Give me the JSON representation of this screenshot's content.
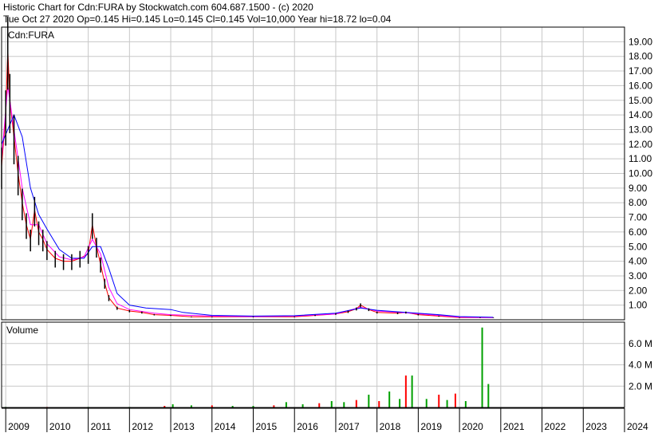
{
  "header": {
    "line1": "Historic Chart for Cdn:FURA by Stockwatch.com 604.687.1500 - (c) 2020",
    "line2": "Tue Oct 27 2020  Op=0.145  Hi=0.145  Lo=0.145  Cl=0.145  Vol=10,000  Year hi=18.72  lo=0.04"
  },
  "chart_data": {
    "type": "line",
    "symbol": "Cdn:FURA",
    "volume_label": "Volume",
    "x_axis": {
      "ticks": [
        "2009",
        "2010",
        "2011",
        "2012",
        "2013",
        "2014",
        "2015",
        "2016",
        "2017",
        "2018",
        "2019",
        "2020",
        "2021",
        "2022",
        "2023",
        "2024"
      ],
      "range": [
        2008.9,
        2024.0
      ]
    },
    "price_axis": {
      "ticks": [
        "19.00",
        "18.00",
        "17.00",
        "16.00",
        "15.00",
        "14.00",
        "13.00",
        "12.00",
        "11.00",
        "10.00",
        "9.00",
        "8.00",
        "7.00",
        "6.00",
        "5.00",
        "4.00",
        "3.00",
        "2.00",
        "1.00"
      ],
      "range": [
        0,
        20.0
      ]
    },
    "volume_axis": {
      "ticks": [
        "6.0 M",
        "4.0 M",
        "2.0 M"
      ],
      "range": [
        0,
        8.0
      ]
    },
    "grid": true,
    "colors": {
      "price": "#000000",
      "ma_short": "#ff0000",
      "ma_mid": "#ff00ff",
      "ma_long": "#0000ff",
      "vol_up": "#00a000",
      "vol_down": "#ff0000"
    },
    "series": [
      {
        "values": [
          [
            2008.9,
            10.5
          ],
          [
            2009.0,
            14.0
          ],
          [
            2009.05,
            18.5
          ],
          [
            2009.1,
            15.0
          ],
          [
            2009.2,
            12.5
          ],
          [
            2009.3,
            10.0
          ],
          [
            2009.4,
            8.0
          ],
          [
            2009.5,
            6.5
          ],
          [
            2009.6,
            5.5
          ],
          [
            2009.7,
            7.5
          ],
          [
            2009.8,
            6.0
          ],
          [
            2009.9,
            5.5
          ],
          [
            2010.0,
            4.8
          ],
          [
            2010.2,
            4.2
          ],
          [
            2010.4,
            4.0
          ],
          [
            2010.6,
            4.0
          ],
          [
            2010.8,
            4.2
          ],
          [
            2011.0,
            4.5
          ],
          [
            2011.1,
            6.5
          ],
          [
            2011.2,
            5.0
          ],
          [
            2011.3,
            3.8
          ],
          [
            2011.4,
            2.5
          ],
          [
            2011.5,
            1.5
          ],
          [
            2011.7,
            0.8
          ],
          [
            2012.0,
            0.6
          ],
          [
            2012.3,
            0.5
          ],
          [
            2012.6,
            0.35
          ],
          [
            2013.0,
            0.3
          ],
          [
            2013.5,
            0.2
          ],
          [
            2014.0,
            0.2
          ],
          [
            2015.0,
            0.2
          ],
          [
            2016.0,
            0.2
          ],
          [
            2016.5,
            0.3
          ],
          [
            2017.0,
            0.4
          ],
          [
            2017.3,
            0.55
          ],
          [
            2017.5,
            0.75
          ],
          [
            2017.6,
            1.0
          ],
          [
            2017.8,
            0.7
          ],
          [
            2018.0,
            0.5
          ],
          [
            2018.5,
            0.45
          ],
          [
            2018.7,
            0.5
          ],
          [
            2019.0,
            0.35
          ],
          [
            2019.5,
            0.25
          ],
          [
            2020.0,
            0.15
          ],
          [
            2020.5,
            0.15
          ],
          [
            2020.82,
            0.145
          ]
        ]
      },
      {
        "values": [
          [
            2008.9,
            11.0
          ],
          [
            2009.05,
            16.0
          ],
          [
            2009.2,
            13.0
          ],
          [
            2009.4,
            9.0
          ],
          [
            2009.6,
            6.5
          ],
          [
            2009.8,
            6.5
          ],
          [
            2010.0,
            5.2
          ],
          [
            2010.3,
            4.3
          ],
          [
            2010.6,
            4.1
          ],
          [
            2010.9,
            4.3
          ],
          [
            2011.1,
            5.5
          ],
          [
            2011.3,
            4.5
          ],
          [
            2011.5,
            2.2
          ],
          [
            2011.7,
            1.1
          ],
          [
            2012.0,
            0.7
          ],
          [
            2012.6,
            0.45
          ],
          [
            2013.0,
            0.35
          ],
          [
            2014.0,
            0.25
          ],
          [
            2015.0,
            0.22
          ],
          [
            2016.0,
            0.25
          ],
          [
            2017.0,
            0.4
          ],
          [
            2017.6,
            0.85
          ],
          [
            2018.0,
            0.6
          ],
          [
            2018.7,
            0.48
          ],
          [
            2019.5,
            0.3
          ],
          [
            2020.0,
            0.18
          ],
          [
            2020.82,
            0.15
          ]
        ]
      },
      {
        "values": [
          [
            2008.9,
            12.0
          ],
          [
            2009.2,
            14.0
          ],
          [
            2009.4,
            12.5
          ],
          [
            2009.6,
            9.0
          ],
          [
            2009.8,
            7.2
          ],
          [
            2010.0,
            6.2
          ],
          [
            2010.3,
            4.8
          ],
          [
            2010.6,
            4.2
          ],
          [
            2010.9,
            4.2
          ],
          [
            2011.1,
            5.0
          ],
          [
            2011.3,
            5.0
          ],
          [
            2011.5,
            3.5
          ],
          [
            2011.7,
            1.8
          ],
          [
            2012.0,
            1.0
          ],
          [
            2012.4,
            0.8
          ],
          [
            2013.0,
            0.7
          ],
          [
            2013.3,
            0.5
          ],
          [
            2014.0,
            0.3
          ],
          [
            2015.0,
            0.25
          ],
          [
            2016.0,
            0.28
          ],
          [
            2017.0,
            0.45
          ],
          [
            2017.6,
            0.8
          ],
          [
            2018.0,
            0.65
          ],
          [
            2018.7,
            0.5
          ],
          [
            2019.5,
            0.35
          ],
          [
            2020.0,
            0.22
          ],
          [
            2020.82,
            0.17
          ]
        ]
      }
    ],
    "volume": [
      {
        "x": 2009.0,
        "v": 0.05,
        "up": true
      },
      {
        "x": 2010.0,
        "v": 0.05,
        "up": false
      },
      {
        "x": 2011.0,
        "v": 0.05,
        "up": true
      },
      {
        "x": 2012.0,
        "v": 0.05,
        "up": true
      },
      {
        "x": 2012.85,
        "v": 0.15,
        "up": false
      },
      {
        "x": 2013.05,
        "v": 0.3,
        "up": true
      },
      {
        "x": 2013.5,
        "v": 0.2,
        "up": true
      },
      {
        "x": 2014.0,
        "v": 0.2,
        "up": false
      },
      {
        "x": 2014.5,
        "v": 0.15,
        "up": true
      },
      {
        "x": 2015.0,
        "v": 0.15,
        "up": true
      },
      {
        "x": 2015.5,
        "v": 0.2,
        "up": false
      },
      {
        "x": 2015.8,
        "v": 0.5,
        "up": true
      },
      {
        "x": 2016.2,
        "v": 0.3,
        "up": true
      },
      {
        "x": 2016.6,
        "v": 0.4,
        "up": false
      },
      {
        "x": 2016.9,
        "v": 0.6,
        "up": true
      },
      {
        "x": 2017.2,
        "v": 0.5,
        "up": true
      },
      {
        "x": 2017.5,
        "v": 0.7,
        "up": false
      },
      {
        "x": 2017.8,
        "v": 1.2,
        "up": true
      },
      {
        "x": 2018.05,
        "v": 0.6,
        "up": false
      },
      {
        "x": 2018.3,
        "v": 1.5,
        "up": true
      },
      {
        "x": 2018.55,
        "v": 0.8,
        "up": true
      },
      {
        "x": 2018.7,
        "v": 3.0,
        "up": false
      },
      {
        "x": 2018.85,
        "v": 3.0,
        "up": true
      },
      {
        "x": 2019.2,
        "v": 0.8,
        "up": true
      },
      {
        "x": 2019.5,
        "v": 1.2,
        "up": false
      },
      {
        "x": 2019.7,
        "v": 0.7,
        "up": true
      },
      {
        "x": 2019.9,
        "v": 1.3,
        "up": false
      },
      {
        "x": 2020.15,
        "v": 0.6,
        "up": true
      },
      {
        "x": 2020.55,
        "v": 7.5,
        "up": true
      },
      {
        "x": 2020.7,
        "v": 2.2,
        "up": true
      }
    ]
  }
}
